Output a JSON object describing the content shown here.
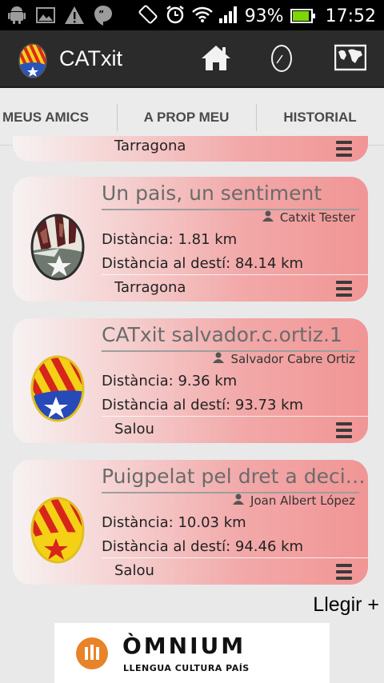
{
  "status_bar": {
    "battery_percent": "93%",
    "battery_level": 0.93,
    "time": "17:52",
    "icons": [
      "android-icon",
      "image-icon",
      "warning-icon",
      "hangouts-icon",
      "rotate-icon",
      "alarm-icon",
      "wifi-icon",
      "signal-icon",
      "battery-icon"
    ]
  },
  "app_bar": {
    "title": "CATxit",
    "actions": [
      "home-icon",
      "egg-icon",
      "map-icon"
    ],
    "colors": {
      "background": "#2b2b2b"
    }
  },
  "tabs": [
    {
      "label": "MEUS AMICS",
      "selected": false
    },
    {
      "label": "A PROP MEU",
      "selected": true
    },
    {
      "label": "HISTORIAL",
      "selected": false
    }
  ],
  "partial_card": {
    "city": "Tarragona"
  },
  "cards": [
    {
      "title": "Un pais, un sentiment",
      "author": "Catxit Tester",
      "distance": "Distància: 1.81 km",
      "destination_distance": "Distància al destí: 84.14 km",
      "city": "Tarragona",
      "egg": "camouflage-egg-icon"
    },
    {
      "title": "CATxit salvador.c.ortiz.1",
      "author": "Salvador Cabre Ortiz",
      "distance": "Distància: 9.36 km",
      "destination_distance": "Distància al destí: 93.73 km",
      "city": "Salou",
      "egg": "estelada-blue-egg-icon"
    },
    {
      "title": "Puigpelat pel dret a decidir",
      "author": "Joan Albert López",
      "distance": "Distància: 10.03 km",
      "destination_distance": "Distància al destí: 94.46 km",
      "city": "Salou",
      "egg": "estelada-red-egg-icon"
    }
  ],
  "more_link": "Llegir +",
  "banner": {
    "name": "ÒMNIUM",
    "subtitle": "LLENGUA CULTURA PAÍS",
    "brand_color": "#e8832a"
  },
  "colors": {
    "accent": "#f06e6e",
    "card_gradient_end": "#f19595",
    "background": "#e9e9e9"
  }
}
